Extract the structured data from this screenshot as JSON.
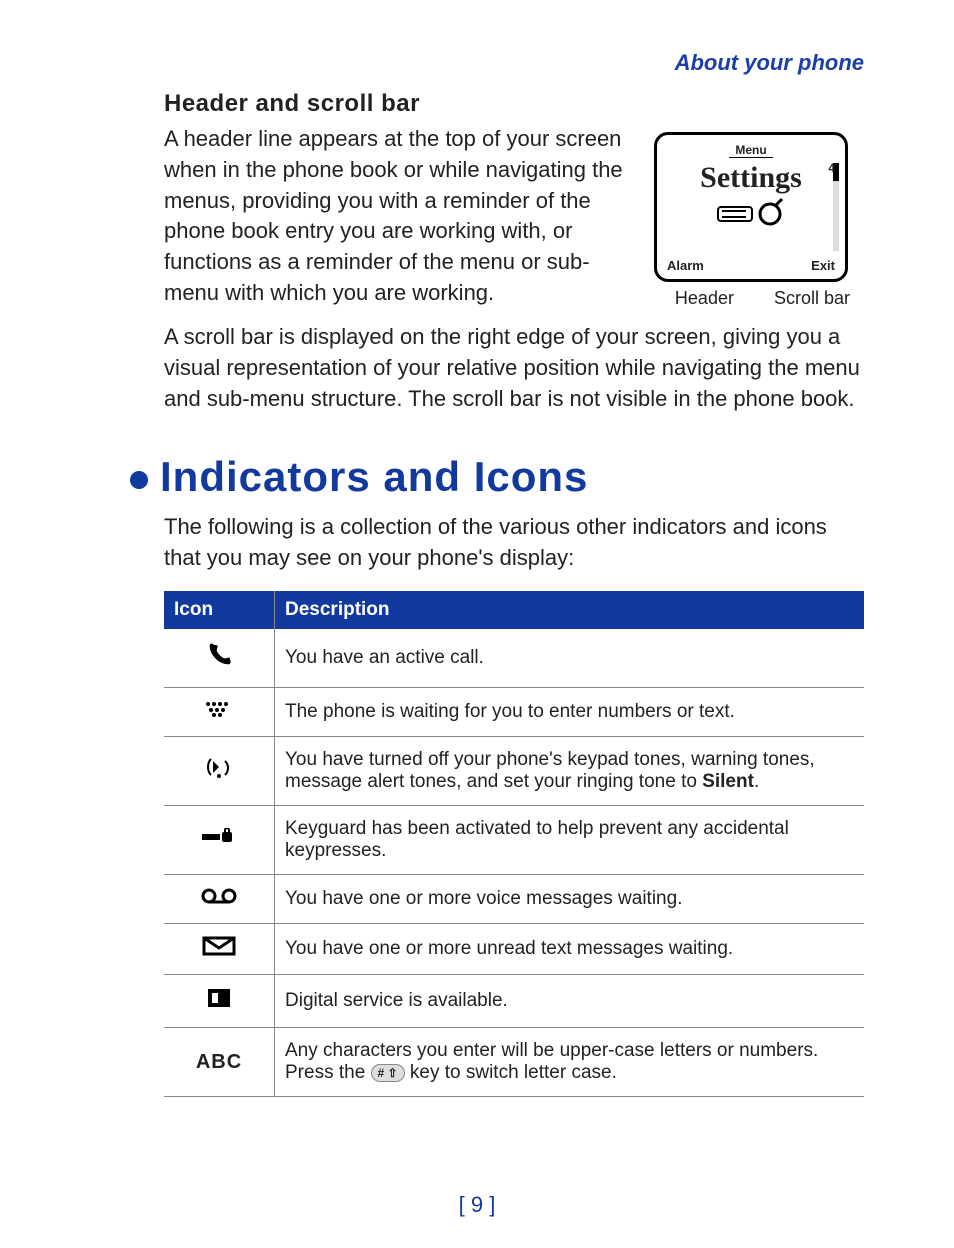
{
  "sectionLabel": "About your phone",
  "sub1": {
    "heading": "Header and scroll bar",
    "para1": "A header line appears at the top of your screen when in the phone book or while navigating the menus, providing you with a reminder of the phone book entry you are working with, or functions as a reminder of the menu or sub-menu with which you are working.",
    "para2": "A scroll bar is displayed on the right edge of your screen, giving you a visual representation of your relative position while navigating the menu and sub-menu structure. The scroll bar is not visible in the phone book."
  },
  "figure": {
    "menuLabel": "Menu",
    "title": "Settings",
    "leftSoftkey": "Alarm",
    "rightSoftkey": "Exit",
    "pageIndicator": "4",
    "captionHeader": "Header",
    "captionScroll": "Scroll bar"
  },
  "section2": {
    "heading": "Indicators and Icons",
    "intro": "The following is a collection of the various other indicators and icons that you may see on your phone's display:"
  },
  "table": {
    "headerIcon": "Icon",
    "headerDesc": "Description",
    "rows": [
      {
        "iconName": "active-call-icon",
        "desc": "You have an active call."
      },
      {
        "iconName": "text-entry-icon",
        "desc": "The phone is waiting for you to enter numbers or text."
      },
      {
        "iconName": "silent-icon",
        "desc_pre": "You have turned off your phone's keypad tones, warning tones, message alert tones, and set your ringing tone to ",
        "desc_bold": "Silent",
        "desc_post": "."
      },
      {
        "iconName": "keyguard-icon",
        "desc": "Keyguard has been activated to help prevent any accidental keypresses."
      },
      {
        "iconName": "voicemail-icon",
        "desc": "You have one or more voice messages waiting."
      },
      {
        "iconName": "message-icon",
        "desc": "You have one or more unread text messages waiting."
      },
      {
        "iconName": "digital-service-icon",
        "desc": "Digital service is available."
      },
      {
        "iconName": "uppercase-abc-icon",
        "iconText": "ABC",
        "desc_pre": "Any characters you enter will be upper-case letters or numbers. Press the ",
        "key": "# ⇧",
        "desc_post": " key to switch letter case."
      }
    ]
  },
  "pageNumber": "[ 9 ]"
}
